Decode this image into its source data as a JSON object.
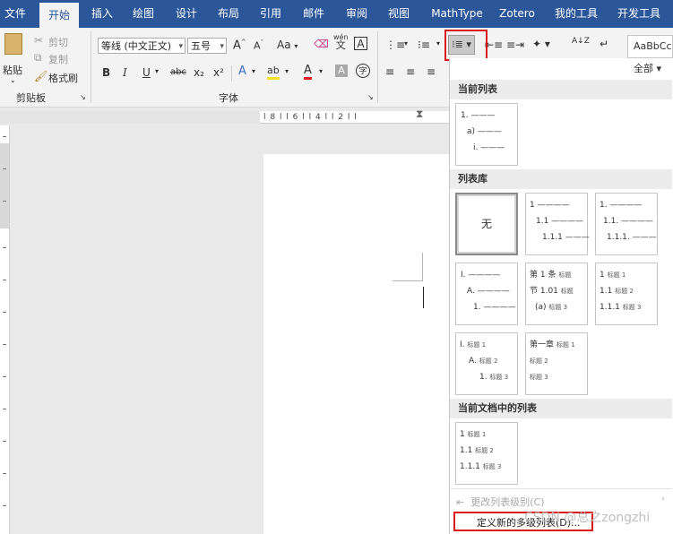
{
  "tabs": [
    {
      "label": "文件",
      "active": false
    },
    {
      "label": "开始",
      "active": true
    },
    {
      "label": "插入",
      "active": false
    },
    {
      "label": "绘图",
      "active": false
    },
    {
      "label": "设计",
      "active": false
    },
    {
      "label": "布局",
      "active": false
    },
    {
      "label": "引用",
      "active": false
    },
    {
      "label": "邮件",
      "active": false
    },
    {
      "label": "审阅",
      "active": false
    },
    {
      "label": "视图",
      "active": false
    },
    {
      "label": "MathType",
      "active": false
    },
    {
      "label": "Zotero",
      "active": false
    },
    {
      "label": "我的工具",
      "active": false
    },
    {
      "label": "开发工具",
      "active": false
    }
  ],
  "clipboard": {
    "paste_label": "粘贴",
    "cut_label": "剪切",
    "copy_label": "复制",
    "format_painter_label": "格式刷",
    "group_label": "剪贴板"
  },
  "font": {
    "font_name": "等线 (中文正文)",
    "font_size": "五号",
    "group_label": "字体",
    "grow_glyph": "A",
    "shrink_glyph": "A",
    "case_glyph": "Aa",
    "bold": "B",
    "italic": "I",
    "underline": "U",
    "strike": "abc",
    "subscript": "x₂",
    "superscript": "x²",
    "phonetic": "wén",
    "phonetic_char": "文",
    "border_char": "A",
    "effects_char": "A",
    "highlight_char": "ab",
    "font_color_char": "A",
    "shading_char": "A",
    "enclose_char": "字"
  },
  "paragraph": {
    "sort_glyph": "A↓Z",
    "marks_glyph": "↵"
  },
  "styles": {
    "preview": "AaBbCc"
  },
  "ruler": {
    "text": "l 8 l   l 6 l   l 4 l   l 2 l   l"
  },
  "dropdown": {
    "filter": "全部 ▾",
    "current_list_header": "当前列表",
    "library_header": "列表库",
    "doc_lists_header": "当前文档中的列表",
    "none_label": "无",
    "change_level": "更改列表级别(C)",
    "define_new": "定义新的多级列表(D)...",
    "current": [
      "1. ———",
      "a) ———",
      "i. ———"
    ],
    "lib1": [
      "1 ————",
      "1.1 ————",
      "1.1.1 ———"
    ],
    "lib2": [
      "1. ————",
      "1.1. ————",
      "1.1.1. ———"
    ],
    "lib3": [
      "I. ————",
      "A. ————",
      "1. ————"
    ],
    "lib4": [
      {
        "num": "第 1 条",
        "text": "标题"
      },
      {
        "num": "节 1.01",
        "text": "标题"
      },
      {
        "num": "(a)",
        "text": "标题 3"
      }
    ],
    "lib5": [
      {
        "num": "1",
        "text": "标题 1"
      },
      {
        "num": "1.1",
        "text": "标题 2"
      },
      {
        "num": "1.1.1",
        "text": "标题 3"
      }
    ],
    "lib6": [
      {
        "num": "I.",
        "text": "标题 1"
      },
      {
        "num": "A.",
        "text": "标题 2"
      },
      {
        "num": "1.",
        "text": "标题 3"
      }
    ],
    "lib7": [
      {
        "num": "第一章",
        "text": "标题 1"
      },
      {
        "num": "",
        "text": "标题 2"
      },
      {
        "num": "",
        "text": "标题 3"
      }
    ],
    "doc1": [
      {
        "num": "1",
        "text": "标题 1"
      },
      {
        "num": "1.1",
        "text": "标题 2"
      },
      {
        "num": "1.1.1",
        "text": "标题 3"
      }
    ]
  },
  "watermark": "CSDN @总之zongzhi",
  "colors": {
    "tab_bar": "#2b579a",
    "highlight_box": "#d91b1b"
  }
}
